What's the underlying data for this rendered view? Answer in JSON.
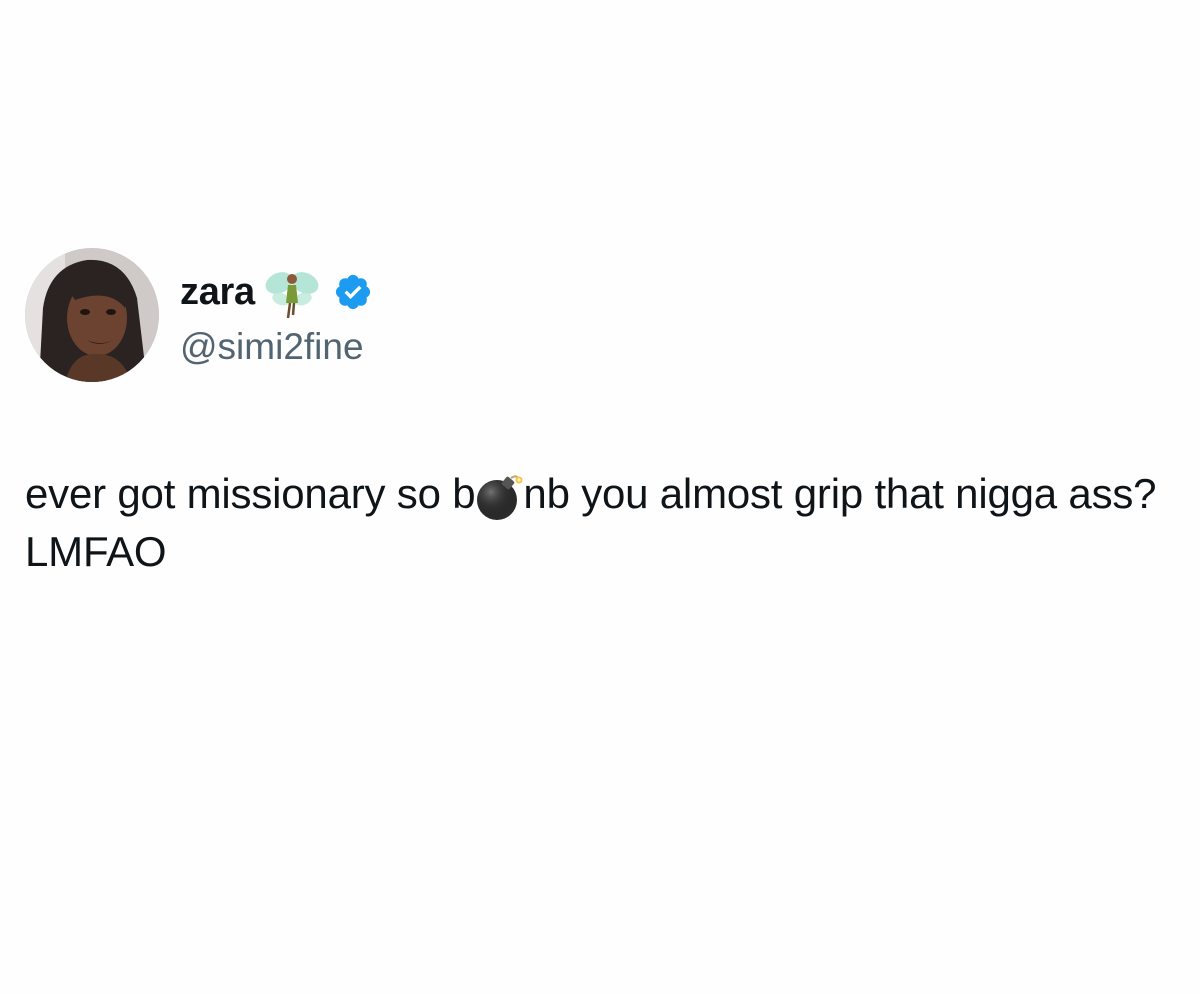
{
  "tweet": {
    "author": {
      "display_name": "zara",
      "handle": "@simi2fine",
      "name_emoji": "fairy-icon",
      "verified_icon": "verified-badge-icon",
      "avatar": "avatar-photo"
    },
    "text": {
      "before_emoji": "ever got missionary so b",
      "emoji": "bomb-icon",
      "after_emoji": "nb you almost grip that nigga ass? LMFAO"
    }
  },
  "colors": {
    "background": "#fefefe",
    "text_primary": "#0f1419",
    "text_secondary": "#536471",
    "verified_blue": "#1d9bf0"
  }
}
